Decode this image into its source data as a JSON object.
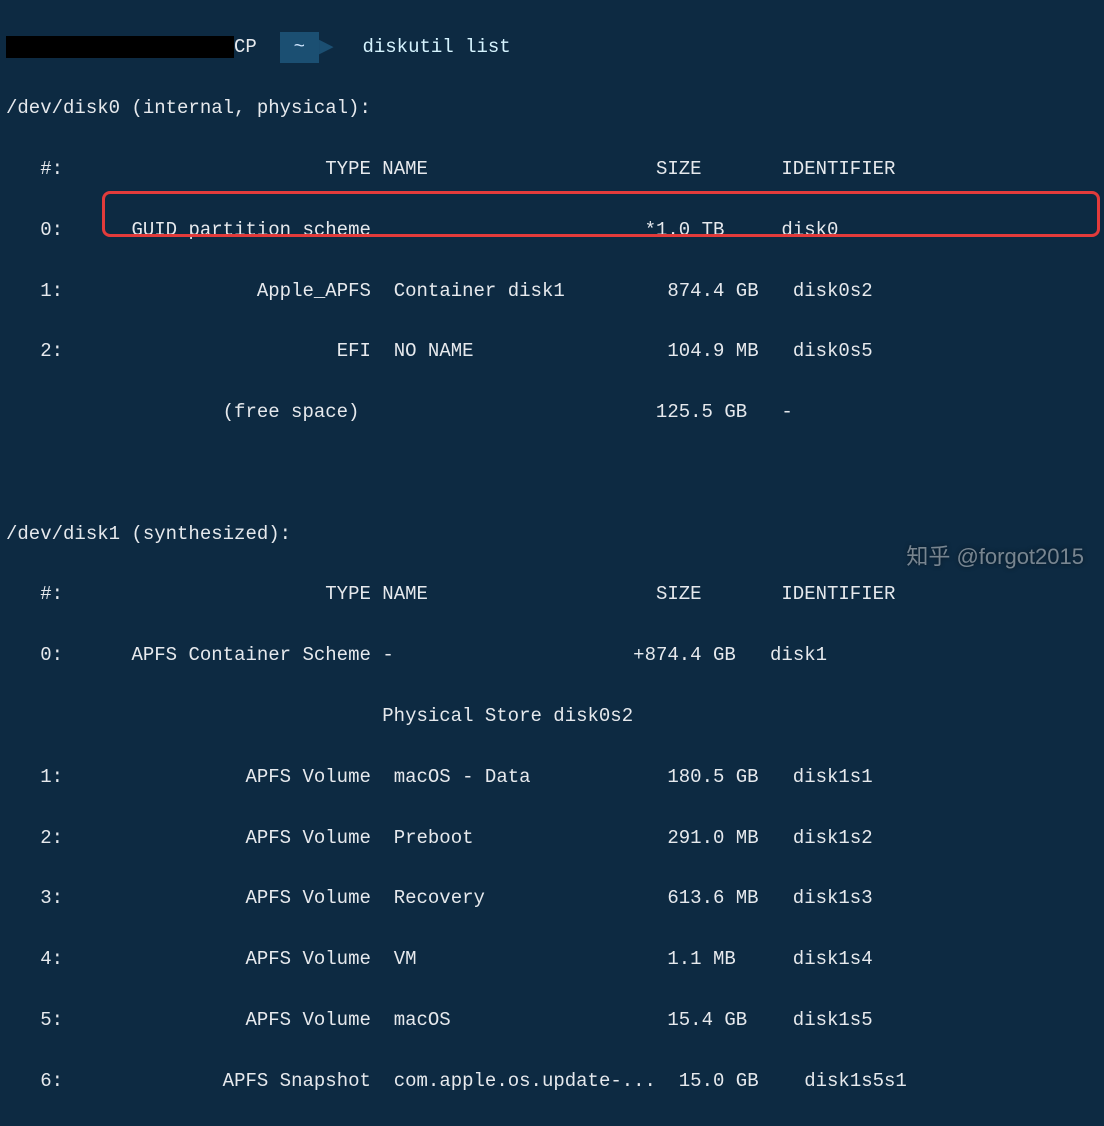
{
  "prompt": {
    "host_suffix": "CP",
    "tilde": "~",
    "command": "diskutil list"
  },
  "disk0": {
    "header": "/dev/disk0 (internal, physical):",
    "cols": {
      "num": "#:",
      "type": "TYPE",
      "name": "NAME",
      "size": "SIZE",
      "id": "IDENTIFIER"
    },
    "rows": [
      {
        "num": "0:",
        "type": "GUID_partition_scheme",
        "name": "",
        "size": "*1.0 TB",
        "id": "disk0"
      },
      {
        "num": "1:",
        "type": "Apple_APFS",
        "name": "Container disk1",
        "size": "874.4 GB",
        "id": "disk0s2"
      },
      {
        "num": "2:",
        "type": "EFI",
        "name": "NO NAME",
        "size": "104.9 MB",
        "id": "disk0s5"
      },
      {
        "num": "",
        "type": "(free space)",
        "name": "",
        "size": "125.5 GB",
        "id": "-"
      }
    ]
  },
  "disk1": {
    "header": "/dev/disk1 (synthesized):",
    "cols": {
      "num": "#:",
      "type": "TYPE",
      "name": "NAME",
      "size": "SIZE",
      "id": "IDENTIFIER"
    },
    "physical_store": "Physical Store disk0s2",
    "rows": [
      {
        "num": "0:",
        "type": "APFS Container Scheme",
        "name": "-",
        "size": "+874.4 GB",
        "id": "disk1"
      },
      {
        "num": "1:",
        "type": "APFS Volume",
        "name": "macOS - Data",
        "size": "180.5 GB",
        "id": "disk1s1"
      },
      {
        "num": "2:",
        "type": "APFS Volume",
        "name": "Preboot",
        "size": "291.0 MB",
        "id": "disk1s2"
      },
      {
        "num": "3:",
        "type": "APFS Volume",
        "name": "Recovery",
        "size": "613.6 MB",
        "id": "disk1s3"
      },
      {
        "num": "4:",
        "type": "APFS Volume",
        "name": "VM",
        "size": "1.1 MB",
        "id": "disk1s4"
      },
      {
        "num": "5:",
        "type": "APFS Volume",
        "name": "macOS",
        "size": "15.4 GB",
        "id": "disk1s5"
      },
      {
        "num": "6:",
        "type": "APFS Snapshot",
        "name": "com.apple.os.update-...",
        "size": "15.0 GB",
        "id": "disk1s5s1"
      }
    ]
  },
  "watermark": "知乎 @forgot2015"
}
